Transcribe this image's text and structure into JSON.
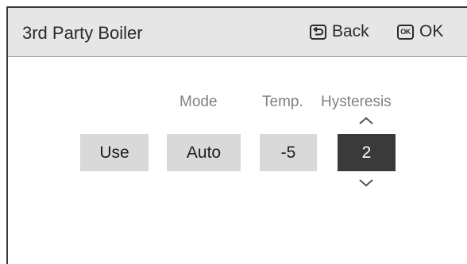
{
  "header": {
    "title": "3rd Party Boiler",
    "back_label": "Back",
    "ok_key_text": "OK",
    "ok_label": "OK"
  },
  "columns": {
    "mode_label": "Mode",
    "temp_label": "Temp.",
    "hysteresis_label": "Hysteresis"
  },
  "fields": {
    "use": "Use",
    "mode": "Auto",
    "temp": "-5",
    "hysteresis": "2"
  },
  "icons": {
    "back": "return-arrow-icon",
    "ok": "ok-key-icon",
    "up": "chevron-up-icon",
    "down": "chevron-down-icon"
  },
  "colors": {
    "header_bg": "#e6e6e6",
    "field_bg": "#d9d9d9",
    "selected_bg": "#3a3a3a",
    "label_gray": "#808080"
  }
}
